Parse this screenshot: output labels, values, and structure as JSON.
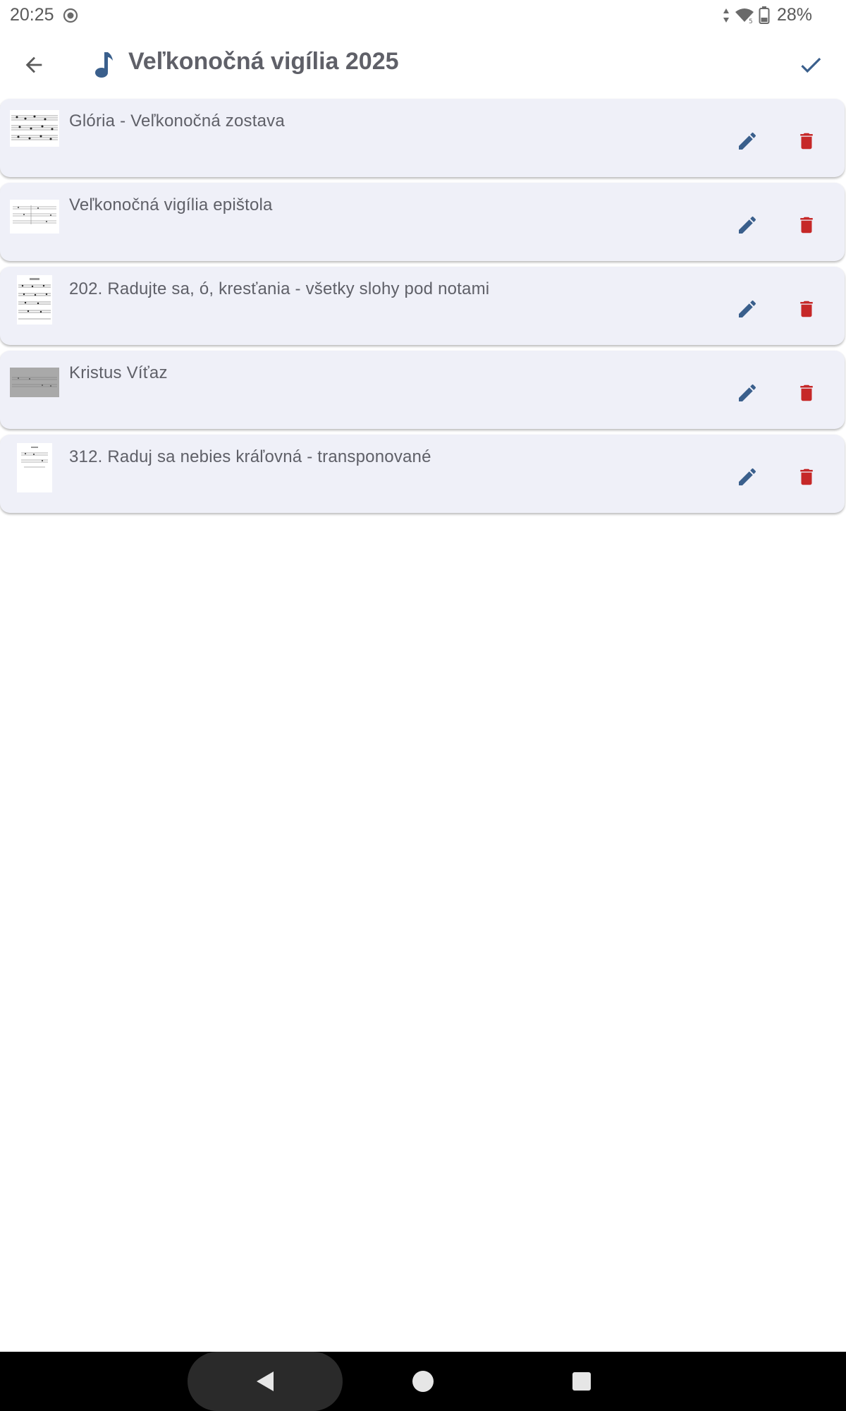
{
  "status": {
    "time": "20:25",
    "battery_percent": "28%",
    "icons": [
      "screen-record-icon",
      "data-arrows-icon",
      "wifi-icon",
      "battery-icon"
    ]
  },
  "app_bar": {
    "title": "Veľkonočná vigília 2025",
    "icons": [
      "back-arrow-icon",
      "music-note-icon",
      "check-icon"
    ]
  },
  "songs": [
    {
      "title": "Glória - Veľkonočná zostava"
    },
    {
      "title": "Veľkonočná vigília epištola"
    },
    {
      "title": "202. Radujte sa, ó, kresťania - všetky slohy pod notami"
    },
    {
      "title": "Kristus Víťaz"
    },
    {
      "title": "312. Raduj sa nebies kráľovná - transponované"
    }
  ],
  "item_actions": {
    "edit_icon": "pencil-icon",
    "delete_icon": "trash-icon"
  },
  "colors": {
    "accent": "#3a5f8c",
    "delete": "#c62828",
    "card_bg": "#eff0f8",
    "text": "#5f6068"
  },
  "nav": {
    "icons": [
      "back-triangle-icon",
      "home-circle-icon",
      "recents-square-icon"
    ]
  }
}
